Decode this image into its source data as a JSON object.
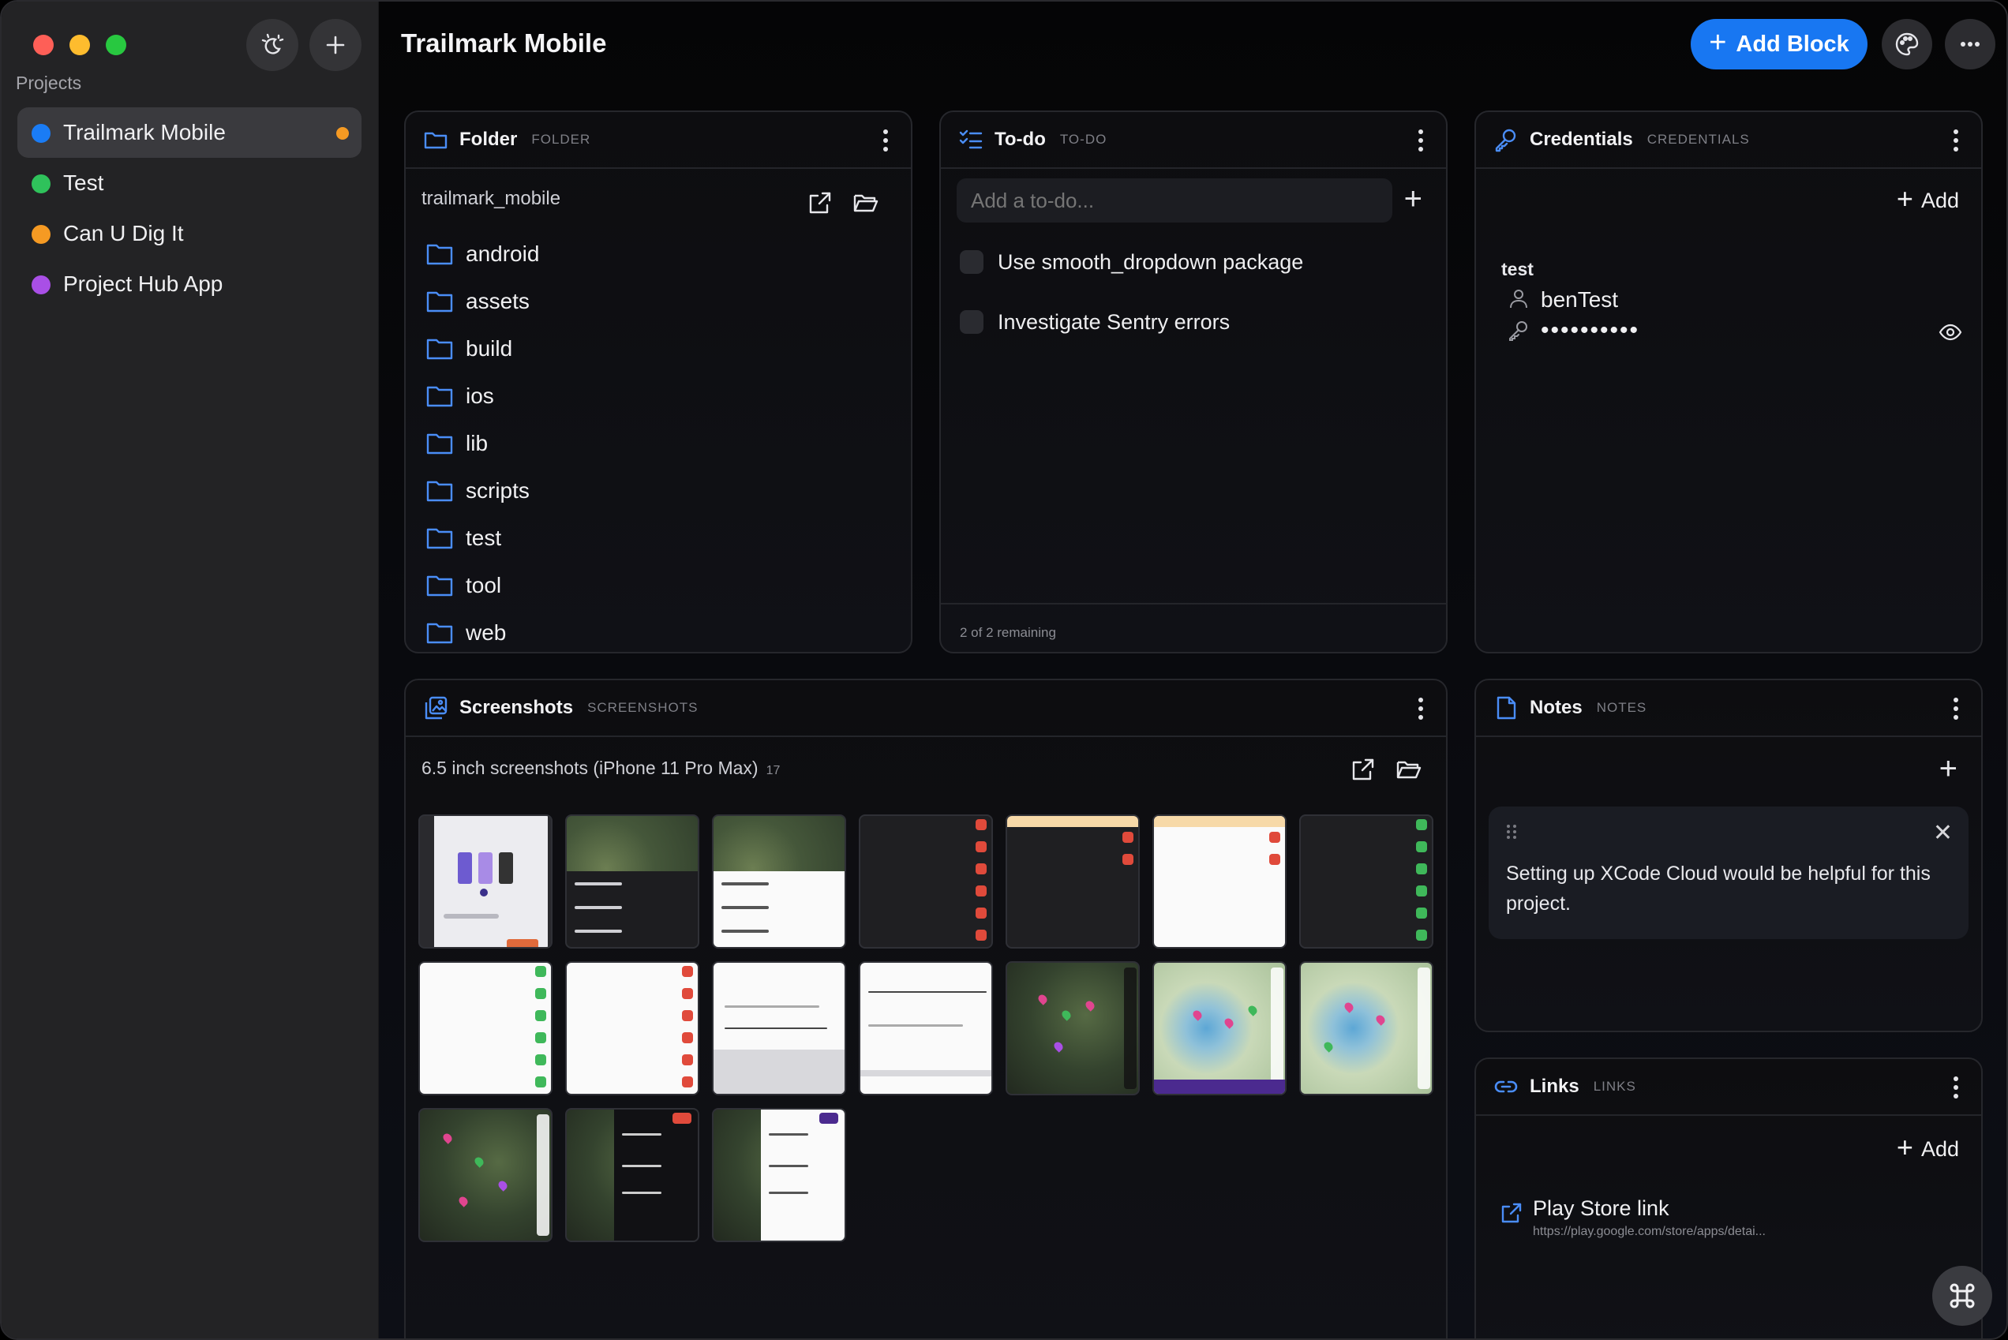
{
  "sidebar": {
    "section_label": "Projects",
    "projects": [
      {
        "label": "Trailmark Mobile",
        "color": "#1a7cf5",
        "active": true
      },
      {
        "label": "Test",
        "color": "#2fc25b"
      },
      {
        "label": "Can U Dig It",
        "color": "#f59a23"
      },
      {
        "label": "Project Hub App",
        "color": "#a94fe6"
      }
    ]
  },
  "header": {
    "title": "Trailmark Mobile",
    "add_block_label": "Add Block"
  },
  "folder": {
    "title": "Folder",
    "type": "FOLDER",
    "path": "trailmark_mobile",
    "items": [
      "android",
      "assets",
      "build",
      "ios",
      "lib",
      "scripts",
      "test",
      "tool",
      "web"
    ]
  },
  "todo": {
    "title": "To-do",
    "type": "TO-DO",
    "placeholder": "Add a to-do...",
    "items": [
      "Use smooth_dropdown package",
      "Investigate Sentry errors"
    ],
    "footer": "2 of 2 remaining"
  },
  "credentials": {
    "title": "Credentials",
    "type": "CREDENTIALS",
    "add_label": "Add",
    "group": "test",
    "username": "benTest",
    "password_mask": "••••••••••"
  },
  "screenshots": {
    "title": "Screenshots",
    "type": "SCREENSHOTS",
    "path": "6.5 inch screenshots (iPhone 11 Pro Max)",
    "count": "17"
  },
  "notes": {
    "title": "Notes",
    "type": "NOTES",
    "note_text": "Setting up XCode Cloud would be helpful for this project."
  },
  "links": {
    "title": "Links",
    "type": "LINKS",
    "add_label": "Add",
    "item_title": "Play Store link",
    "item_url": "https://play.google.com/store/apps/detai..."
  },
  "colors": {
    "accent": "#1877f2",
    "folder_icon": "#4a8df7"
  }
}
